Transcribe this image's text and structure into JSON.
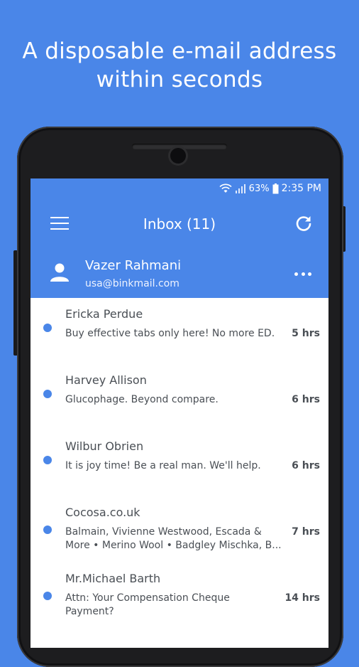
{
  "headline": {
    "line1": "A disposable e-mail address",
    "line2": "within seconds"
  },
  "status_bar": {
    "battery": "63%",
    "time": "2:35 PM"
  },
  "toolbar": {
    "title": "Inbox (11)"
  },
  "account": {
    "name": "Vazer Rahmani",
    "email": "usa@binkmail.com"
  },
  "emails": [
    {
      "sender": "Ericka Perdue",
      "preview": "Buy effective tabs only here! No more ED.",
      "age": "5 hrs",
      "unread": true
    },
    {
      "sender": "Harvey Allison",
      "preview": "Glucophage. Beyond compare.",
      "age": "6 hrs",
      "unread": true
    },
    {
      "sender": "Wilbur Obrien",
      "preview": "It is joy time! Be a real man. We'll help.",
      "age": "6 hrs",
      "unread": true
    },
    {
      "sender": "Cocosa.co.uk",
      "preview_line1": "Balmain, Vivienne Westwood, Escada &",
      "preview_line2": "More • Merino Wool • Badgley Mischka, B...",
      "age": "7 hrs",
      "unread": true
    },
    {
      "sender": "Mr.Michael Barth",
      "preview_line1": "Attn: Your Compensation Cheque",
      "preview_line2": "Payment?",
      "age": "14 hrs",
      "unread": true
    }
  ],
  "colors": {
    "accent": "#4a86e8",
    "text": "#4a4f55"
  },
  "icons": [
    "menu-icon",
    "refresh-icon",
    "person-icon",
    "more-options-icon",
    "wifi-icon",
    "signal-icon",
    "battery-icon"
  ]
}
